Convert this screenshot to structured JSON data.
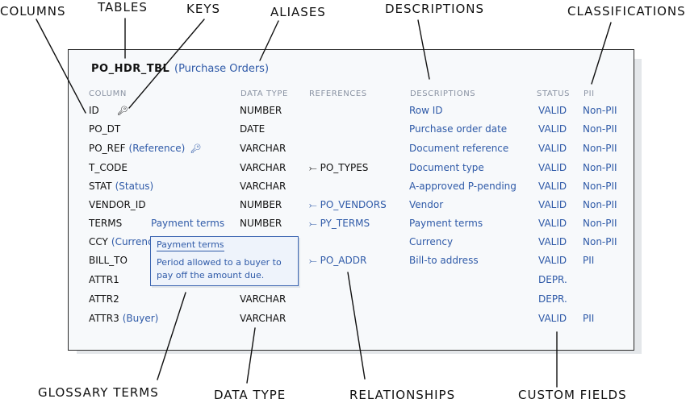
{
  "callouts": {
    "columns": "Columns",
    "tables": "Tables",
    "keys": "Keys",
    "aliases": "Aliases",
    "descriptions": "Descriptions",
    "classifications": "Classifications",
    "glossary_terms": "Glossary Terms",
    "data_type": "Data Type",
    "relationships": "Relationships",
    "custom_fields": "Custom Fields"
  },
  "table": {
    "name": "PO_HDR_TBL",
    "alias": "(Purchase Orders)",
    "headers": {
      "column": "Column",
      "data_type": "Data Type",
      "references": "References",
      "descriptions": "Descriptions",
      "status": "Status",
      "pii": "PII"
    },
    "rows": [
      {
        "column": "ID",
        "alias": "",
        "key": true,
        "glossary": "",
        "type": "NUMBER",
        "ref": "",
        "desc": "Row ID",
        "status": "VALID",
        "pii": "Non-PII"
      },
      {
        "column": "PO_DT",
        "alias": "",
        "key": false,
        "glossary": "",
        "type": "DATE",
        "ref": "",
        "desc": "Purchase order date",
        "status": "VALID",
        "pii": "Non-PII"
      },
      {
        "column": "PO_REF",
        "alias": "(Reference)",
        "key": true,
        "glossary": "",
        "type": "VARCHAR",
        "ref": "",
        "desc": "Document reference",
        "status": "VALID",
        "pii": "Non-PII"
      },
      {
        "column": "T_CODE",
        "alias": "",
        "key": false,
        "glossary": "",
        "type": "VARCHAR",
        "ref": "PO_TYPES",
        "desc": "Document type",
        "status": "VALID",
        "pii": "Non-PII"
      },
      {
        "column": "STAT",
        "alias": "(Status)",
        "key": false,
        "glossary": "",
        "type": "VARCHAR",
        "ref": "",
        "desc": "A-approved P-pending",
        "status": "VALID",
        "pii": "Non-PII"
      },
      {
        "column": "VENDOR_ID",
        "alias": "",
        "key": false,
        "glossary": "",
        "type": "NUMBER",
        "ref": "PO_VENDORS",
        "desc": "Vendor",
        "status": "VALID",
        "pii": "Non-PII"
      },
      {
        "column": "TERMS",
        "alias": "",
        "key": false,
        "glossary": "Payment terms",
        "type": "NUMBER",
        "ref": "PY_TERMS",
        "desc": "Payment terms",
        "status": "VALID",
        "pii": "Non-PII"
      },
      {
        "column": "CCY",
        "alias": "(Currency)",
        "key": false,
        "glossary": "",
        "type": "",
        "ref": "",
        "desc": "Currency",
        "status": "VALID",
        "pii": "Non-PII"
      },
      {
        "column": "BILL_TO",
        "alias": "",
        "key": false,
        "glossary": "",
        "type": "",
        "ref": "PO_ADDR",
        "desc": "Bill-to address",
        "status": "VALID",
        "pii": "PII"
      },
      {
        "column": "ATTR1",
        "alias": "",
        "key": false,
        "glossary": "",
        "type": "",
        "ref": "",
        "desc": "",
        "status": "DEPR.",
        "pii": ""
      },
      {
        "column": "ATTR2",
        "alias": "",
        "key": false,
        "glossary": "",
        "type": "VARCHAR",
        "ref": "",
        "desc": "",
        "status": "DEPR.",
        "pii": ""
      },
      {
        "column": "ATTR3",
        "alias": "(Buyer)",
        "key": false,
        "glossary": "",
        "type": "VARCHAR",
        "ref": "",
        "desc": "",
        "status": "VALID",
        "pii": "PII"
      }
    ]
  },
  "tooltip": {
    "title": "Payment terms",
    "body": "Period allowed to a buyer to pay off the amount due."
  },
  "icons": {
    "key": "🔑︎",
    "arrow": "⤚"
  },
  "colors": {
    "ink": "#111111",
    "accent_blue": "#2f5aa8",
    "panel_bg": "#f7f9fb",
    "shadow": "#e4e7ea",
    "header_gray": "#8a93a3"
  }
}
